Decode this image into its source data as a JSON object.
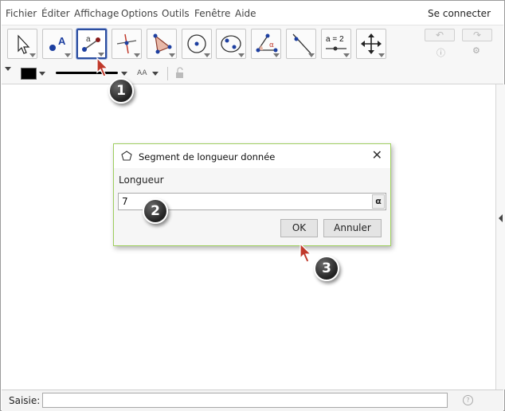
{
  "menu": {
    "items": [
      "Fichier",
      "Éditer",
      "Affichage",
      "Options",
      "Outils",
      "Fenêtre",
      "Aide"
    ],
    "login": "Se connecter"
  },
  "toolbar": {
    "tools": [
      {
        "icon": "move-arrow-icon"
      },
      {
        "icon": "point-icon",
        "label": "A"
      },
      {
        "icon": "segment-fixed-length-icon",
        "label": "a",
        "selected": true
      },
      {
        "icon": "perpendicular-line-icon"
      },
      {
        "icon": "polygon-icon"
      },
      {
        "icon": "circle-center-point-icon"
      },
      {
        "icon": "conic-five-points-icon"
      },
      {
        "icon": "angle-icon",
        "label": "α"
      },
      {
        "icon": "reflect-line-icon"
      },
      {
        "icon": "slider-icon",
        "label": "a = 2"
      },
      {
        "icon": "move-graphics-view-icon"
      }
    ],
    "undo_icon": "undo-icon",
    "redo_icon": "redo-icon",
    "help_icon": "help-icon",
    "settings_icon": "gear-icon"
  },
  "stylebar": {
    "color": "#000000",
    "text_size_label": "AA"
  },
  "dialog": {
    "title": "Segment de longueur donnée",
    "label": "Longueur",
    "value": "7",
    "alpha_button": "α",
    "ok_label": "OK",
    "cancel_label": "Annuler"
  },
  "inputbar": {
    "label": "Saisie:",
    "help": "?"
  },
  "callouts": [
    "1",
    "2",
    "3"
  ],
  "colors": {
    "selected_tool_border": "#2c4ea0",
    "dialog_border": "#9fcf60",
    "cursor_red": "#c0392b"
  }
}
